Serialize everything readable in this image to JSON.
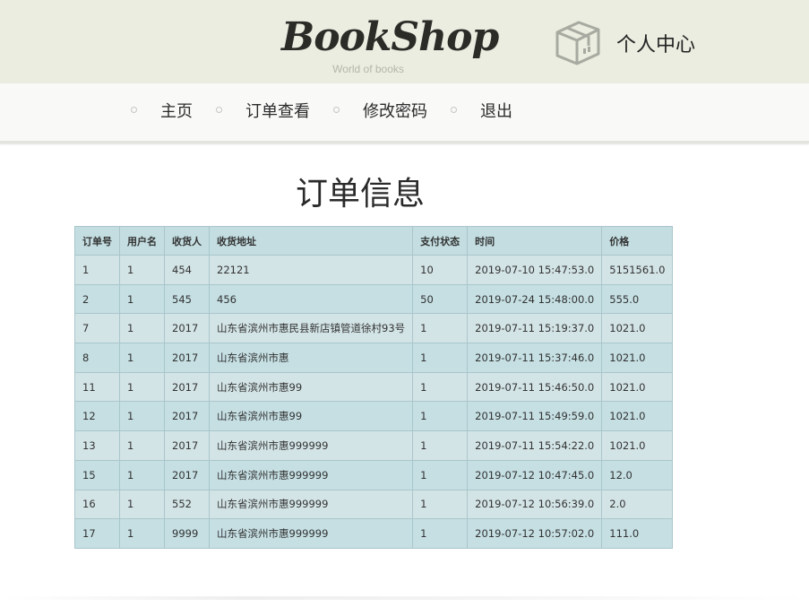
{
  "header": {
    "logo": "BookShop",
    "tagline": "World of books",
    "account_label": "个人中心"
  },
  "nav": {
    "items": [
      {
        "label": "主页"
      },
      {
        "label": "订单查看"
      },
      {
        "label": "修改密码"
      },
      {
        "label": "退出"
      }
    ]
  },
  "main": {
    "title": "订单信息"
  },
  "table": {
    "headers": [
      "订单号",
      "用户名",
      "收货人",
      "收货地址",
      "支付状态",
      "时间",
      "价格"
    ],
    "rows": [
      [
        "1",
        "1",
        "454",
        "22121",
        "10",
        "2019-07-10 15:47:53.0",
        "5151561.0"
      ],
      [
        "2",
        "1",
        "545",
        "456",
        "50",
        "2019-07-24 15:48:00.0",
        "555.0"
      ],
      [
        "7",
        "1",
        "2017",
        "山东省滨州市惠民县新店镇管道徐村93号",
        "1",
        "2019-07-11 15:19:37.0",
        "1021.0"
      ],
      [
        "8",
        "1",
        "2017",
        "山东省滨州市惠",
        "1",
        "2019-07-11 15:37:46.0",
        "1021.0"
      ],
      [
        "11",
        "1",
        "2017",
        "山东省滨州市惠99",
        "1",
        "2019-07-11 15:46:50.0",
        "1021.0"
      ],
      [
        "12",
        "1",
        "2017",
        "山东省滨州市惠99",
        "1",
        "2019-07-11 15:49:59.0",
        "1021.0"
      ],
      [
        "13",
        "1",
        "2017",
        "山东省滨州市惠999999",
        "1",
        "2019-07-11 15:54:22.0",
        "1021.0"
      ],
      [
        "15",
        "1",
        "2017",
        "山东省滨州市惠999999",
        "1",
        "2019-07-12 10:47:45.0",
        "12.0"
      ],
      [
        "16",
        "1",
        "552",
        "山东省滨州市惠999999",
        "1",
        "2019-07-12 10:56:39.0",
        "2.0"
      ],
      [
        "17",
        "1",
        "9999",
        "山东省滨州市惠999999",
        "1",
        "2019-07-12 10:57:02.0",
        "111.0"
      ]
    ]
  },
  "icons": {
    "account": "box-icon",
    "nav_bullet": "circle-bullet-icon"
  },
  "colors": {
    "header_bg": "#eaeddf",
    "nav_bg": "#f9f9f7",
    "table_header_bg": "#c3dde1",
    "table_row_odd": "#d3e4e7",
    "table_row_even": "#c5dfe3",
    "table_border": "#a9c6cb"
  }
}
